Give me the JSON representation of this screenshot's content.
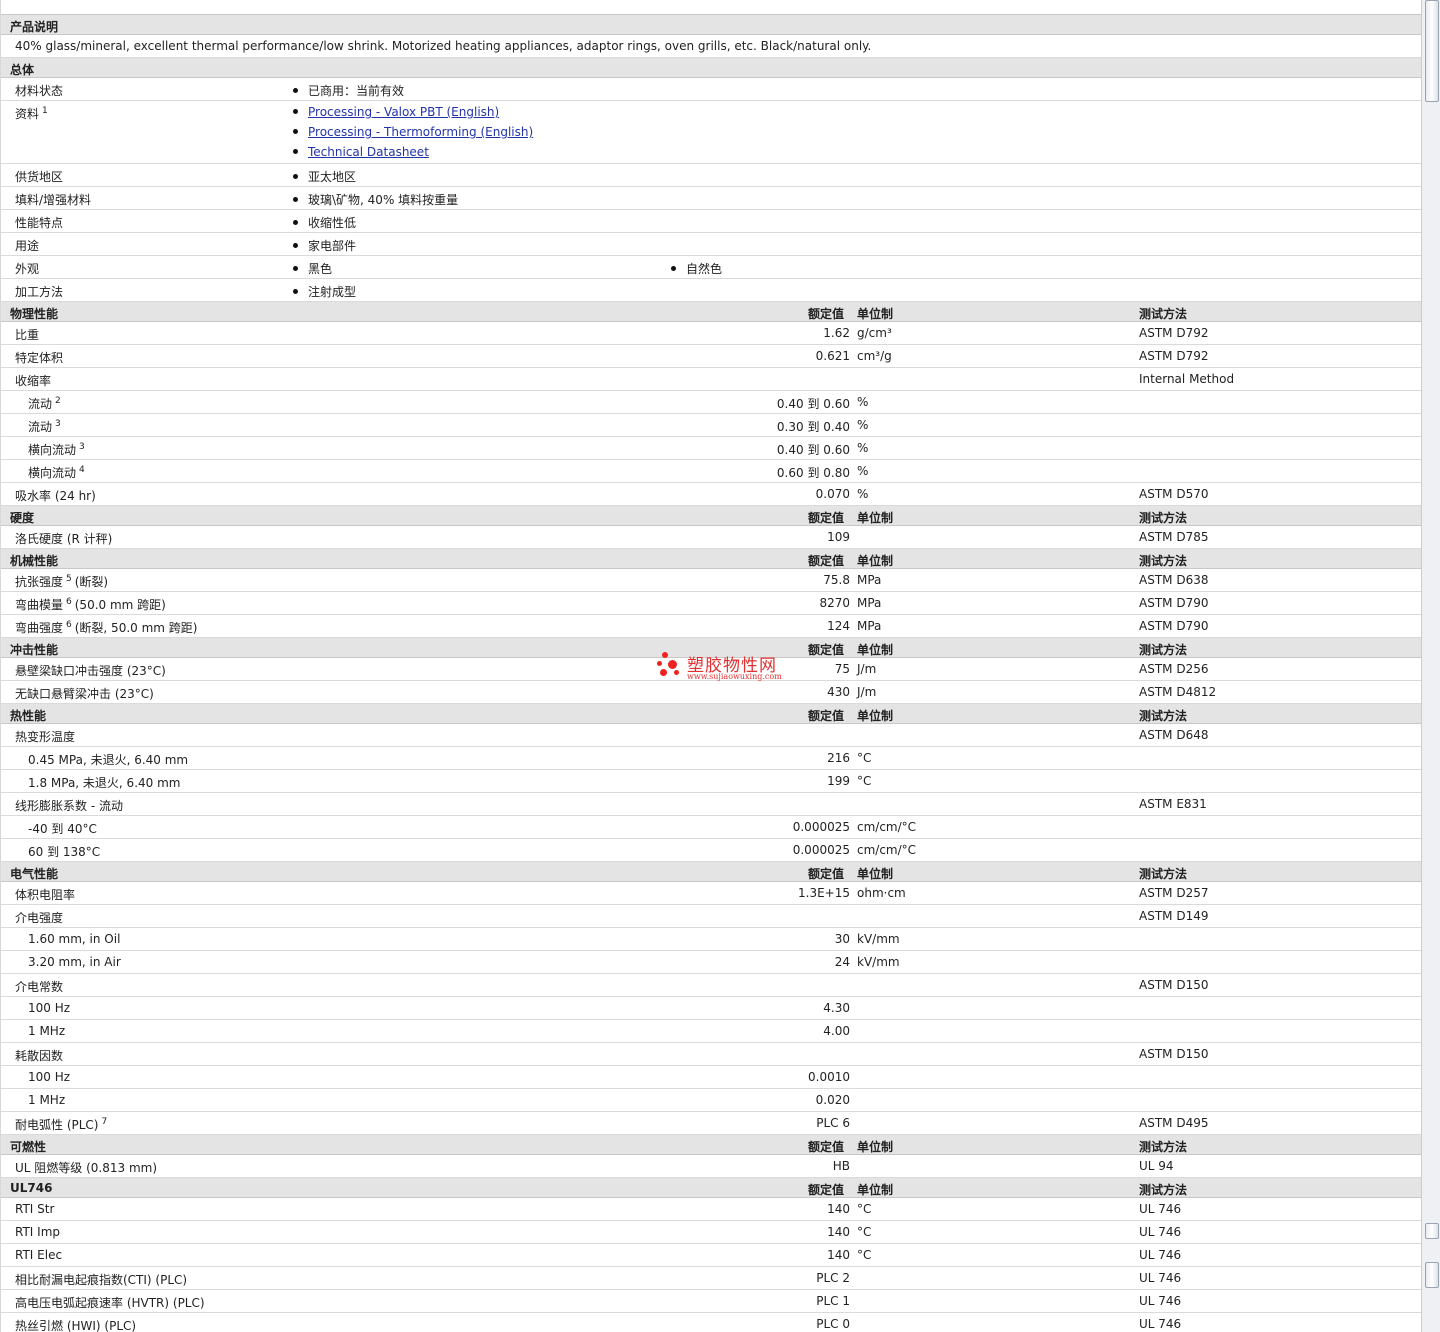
{
  "description": {
    "header": "产品说明",
    "text": "40% glass/mineral, excellent thermal performance/low shrink. Motorized heating appliances, adaptor rings, oven grills, etc. Black/natural only."
  },
  "general": {
    "header": "总体",
    "rows": [
      {
        "label": "材料状态",
        "items": [
          "已商用：当前有效"
        ]
      },
      {
        "label": "资料",
        "sup": "1",
        "links": [
          "Processing - Valox PBT (English)",
          "Processing - Thermoforming (English)",
          "Technical Datasheet"
        ]
      },
      {
        "label": "供货地区",
        "items": [
          "亚太地区"
        ]
      },
      {
        "label": "填料/增强材料",
        "items": [
          "玻璃\\矿物, 40% 填料按重量"
        ]
      },
      {
        "label": "性能特点",
        "items": [
          "收缩性低"
        ]
      },
      {
        "label": "用途",
        "items": [
          "家电部件"
        ]
      },
      {
        "label": "外观",
        "items": [
          "黑色",
          "自然色"
        ]
      },
      {
        "label": "加工方法",
        "items": [
          "注射成型"
        ]
      }
    ]
  },
  "col_headers": {
    "value": "额定值",
    "unit": "单位制",
    "test": "测试方法"
  },
  "sections": [
    {
      "title": "物理性能",
      "rows": [
        {
          "label": "比重",
          "value": "1.62",
          "unit": "g/cm³",
          "test": "ASTM D792"
        },
        {
          "label": "特定体积",
          "value": "0.621",
          "unit": "cm³/g",
          "test": "ASTM D792"
        },
        {
          "label": "收缩率",
          "value": "",
          "unit": "",
          "test": "Internal Method"
        },
        {
          "label": "流动",
          "sup": "2",
          "sub": true,
          "value": "0.40 到  0.60",
          "unit": "%",
          "test": ""
        },
        {
          "label": "流动",
          "sup": "3",
          "sub": true,
          "value": "0.30 到  0.40",
          "unit": "%",
          "test": ""
        },
        {
          "label": "横向流动",
          "sup": "3",
          "sub": true,
          "value": "0.40 到  0.60",
          "unit": "%",
          "test": ""
        },
        {
          "label": "横向流动",
          "sup": "4",
          "sub": true,
          "value": "0.60 到  0.80",
          "unit": "%",
          "test": ""
        },
        {
          "label": "吸水率  (24 hr)",
          "value": "0.070",
          "unit": "%",
          "test": "ASTM D570"
        }
      ]
    },
    {
      "title": "硬度",
      "rows": [
        {
          "label": "洛氏硬度  (R 计秤)",
          "value": "109",
          "unit": "",
          "test": "ASTM D785"
        }
      ]
    },
    {
      "title": "机械性能",
      "rows": [
        {
          "label": "抗张强度",
          "sup": "5",
          "suffix": "(断裂)",
          "value": "75.8",
          "unit": "MPa",
          "test": "ASTM D638"
        },
        {
          "label": "弯曲模量",
          "sup": "6",
          "suffix": "(50.0 mm 跨距)",
          "value": "8270",
          "unit": "MPa",
          "test": "ASTM D790"
        },
        {
          "label": "弯曲强度",
          "sup": "6",
          "suffix": "(断裂, 50.0 mm 跨距)",
          "value": "124",
          "unit": "MPa",
          "test": "ASTM D790"
        }
      ]
    },
    {
      "title": "冲击性能",
      "rows": [
        {
          "label": "悬壁梁缺口冲击强度  (23°C)",
          "value": "75",
          "unit": "J/m",
          "test": "ASTM D256"
        },
        {
          "label": "无缺口悬臂梁冲击  (23°C)",
          "value": "430",
          "unit": "J/m",
          "test": "ASTM D4812"
        }
      ]
    },
    {
      "title": "热性能",
      "rows": [
        {
          "label": "热变形温度",
          "value": "",
          "unit": "",
          "test": "ASTM D648"
        },
        {
          "label": "0.45 MPa, 未退火, 6.40 mm",
          "sub": true,
          "value": "216",
          "unit": "°C",
          "test": ""
        },
        {
          "label": "1.8 MPa, 未退火, 6.40 mm",
          "sub": true,
          "value": "199",
          "unit": "°C",
          "test": ""
        },
        {
          "label": "线形膨胀系数  - 流动",
          "value": "",
          "unit": "",
          "test": "ASTM E831"
        },
        {
          "label": "-40 到  40°C",
          "sub": true,
          "value": "0.000025",
          "unit": "cm/cm/°C",
          "test": ""
        },
        {
          "label": "60 到  138°C",
          "sub": true,
          "value": "0.000025",
          "unit": "cm/cm/°C",
          "test": ""
        }
      ]
    },
    {
      "title": "电气性能",
      "rows": [
        {
          "label": "体积电阻率",
          "value": "1.3E+15",
          "unit": "ohm·cm",
          "test": "ASTM D257"
        },
        {
          "label": "介电强度",
          "value": "",
          "unit": "",
          "test": "ASTM D149"
        },
        {
          "label": "1.60 mm, in Oil",
          "sub": true,
          "value": "30",
          "unit": "kV/mm",
          "test": ""
        },
        {
          "label": "3.20 mm, in Air",
          "sub": true,
          "value": "24",
          "unit": "kV/mm",
          "test": ""
        },
        {
          "label": "介电常数",
          "value": "",
          "unit": "",
          "test": "ASTM D150"
        },
        {
          "label": "100 Hz",
          "sub": true,
          "value": "4.30",
          "unit": "",
          "test": ""
        },
        {
          "label": "1 MHz",
          "sub": true,
          "value": "4.00",
          "unit": "",
          "test": ""
        },
        {
          "label": "耗散因数",
          "value": "",
          "unit": "",
          "test": "ASTM D150"
        },
        {
          "label": "100 Hz",
          "sub": true,
          "value": "0.0010",
          "unit": "",
          "test": ""
        },
        {
          "label": "1 MHz",
          "sub": true,
          "value": "0.020",
          "unit": "",
          "test": ""
        },
        {
          "label": "耐电弧性  (PLC)",
          "sup": "7",
          "value": "PLC 6",
          "unit": "",
          "test": "ASTM D495"
        }
      ]
    },
    {
      "title": "可燃性",
      "rows": [
        {
          "label": "UL 阻燃等级  (0.813 mm)",
          "value": "HB",
          "unit": "",
          "test": "UL 94"
        }
      ]
    },
    {
      "title": "UL746",
      "rows": [
        {
          "label": "RTI Str",
          "value": "140",
          "unit": "°C",
          "test": "UL 746"
        },
        {
          "label": "RTI Imp",
          "value": "140",
          "unit": "°C",
          "test": "UL 746"
        },
        {
          "label": "RTI Elec",
          "value": "140",
          "unit": "°C",
          "test": "UL 746"
        },
        {
          "label": "相比耐漏电起痕指数(CTI) (PLC)",
          "value": "PLC 2",
          "unit": "",
          "test": "UL 746"
        },
        {
          "label": "高电压电弧起痕速率  (HVTR) (PLC)",
          "value": "PLC 1",
          "unit": "",
          "test": "UL 746"
        },
        {
          "label": "热丝引燃  (HWI) (PLC)",
          "value": "PLC 0",
          "unit": "",
          "test": "UL 746"
        }
      ]
    }
  ],
  "watermark": {
    "text": "塑胶物性网",
    "url": "www.sujiaowuxing.com",
    "color": "#e23030"
  },
  "colors": {
    "header_bg": "#e4e4e4",
    "link": "#2233aa"
  }
}
